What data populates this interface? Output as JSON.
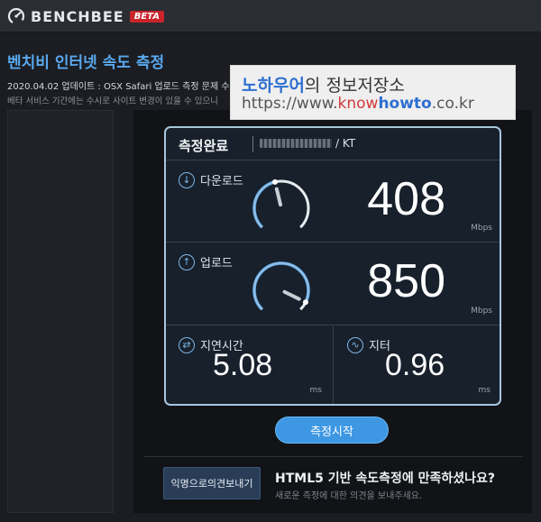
{
  "header": {
    "logo_text": "BENCHBEE",
    "beta_label": "BETA"
  },
  "page": {
    "title": "벤치비 인터넷 속도 측정",
    "notice_update": "2020.04.02 업데이트 : OSX Safari 업로드 측정 문제 수정",
    "notice_beta": "베타 서비스 기간에는 수시로 사이트 변경이 있을 수 있으니 "
  },
  "watermark": {
    "name_highlight": "노하우어",
    "name_rest": "의 정보저장소",
    "url_prefix": "https://www.",
    "url_know": "know",
    "url_howto": "howto",
    "url_suffix": ".co.kr"
  },
  "result": {
    "status": "측정완료",
    "isp": "/ KT",
    "download": {
      "label": "다운로드",
      "value": "408",
      "unit": "Mbps",
      "gauge_level": 0.45
    },
    "upload": {
      "label": "업로드",
      "value": "850",
      "unit": "Mbps",
      "gauge_level": 0.93
    },
    "latency": {
      "label": "지연시간",
      "value": "5.08",
      "unit": "ms"
    },
    "jitter": {
      "label": "지터",
      "value": "0.96",
      "unit": "ms"
    }
  },
  "actions": {
    "start_label": "측정시작",
    "anon_feedback_label": "익명으로의견보내기"
  },
  "footer": {
    "question": "HTML5 기반 속도측정에 만족하셨나요?",
    "subtitle": "새로운 측정에 대한 의견을 보내주세요."
  },
  "colors": {
    "accent": "#3d97e3",
    "title_blue": "#5aa8ee",
    "beta_red": "#c9252b"
  }
}
